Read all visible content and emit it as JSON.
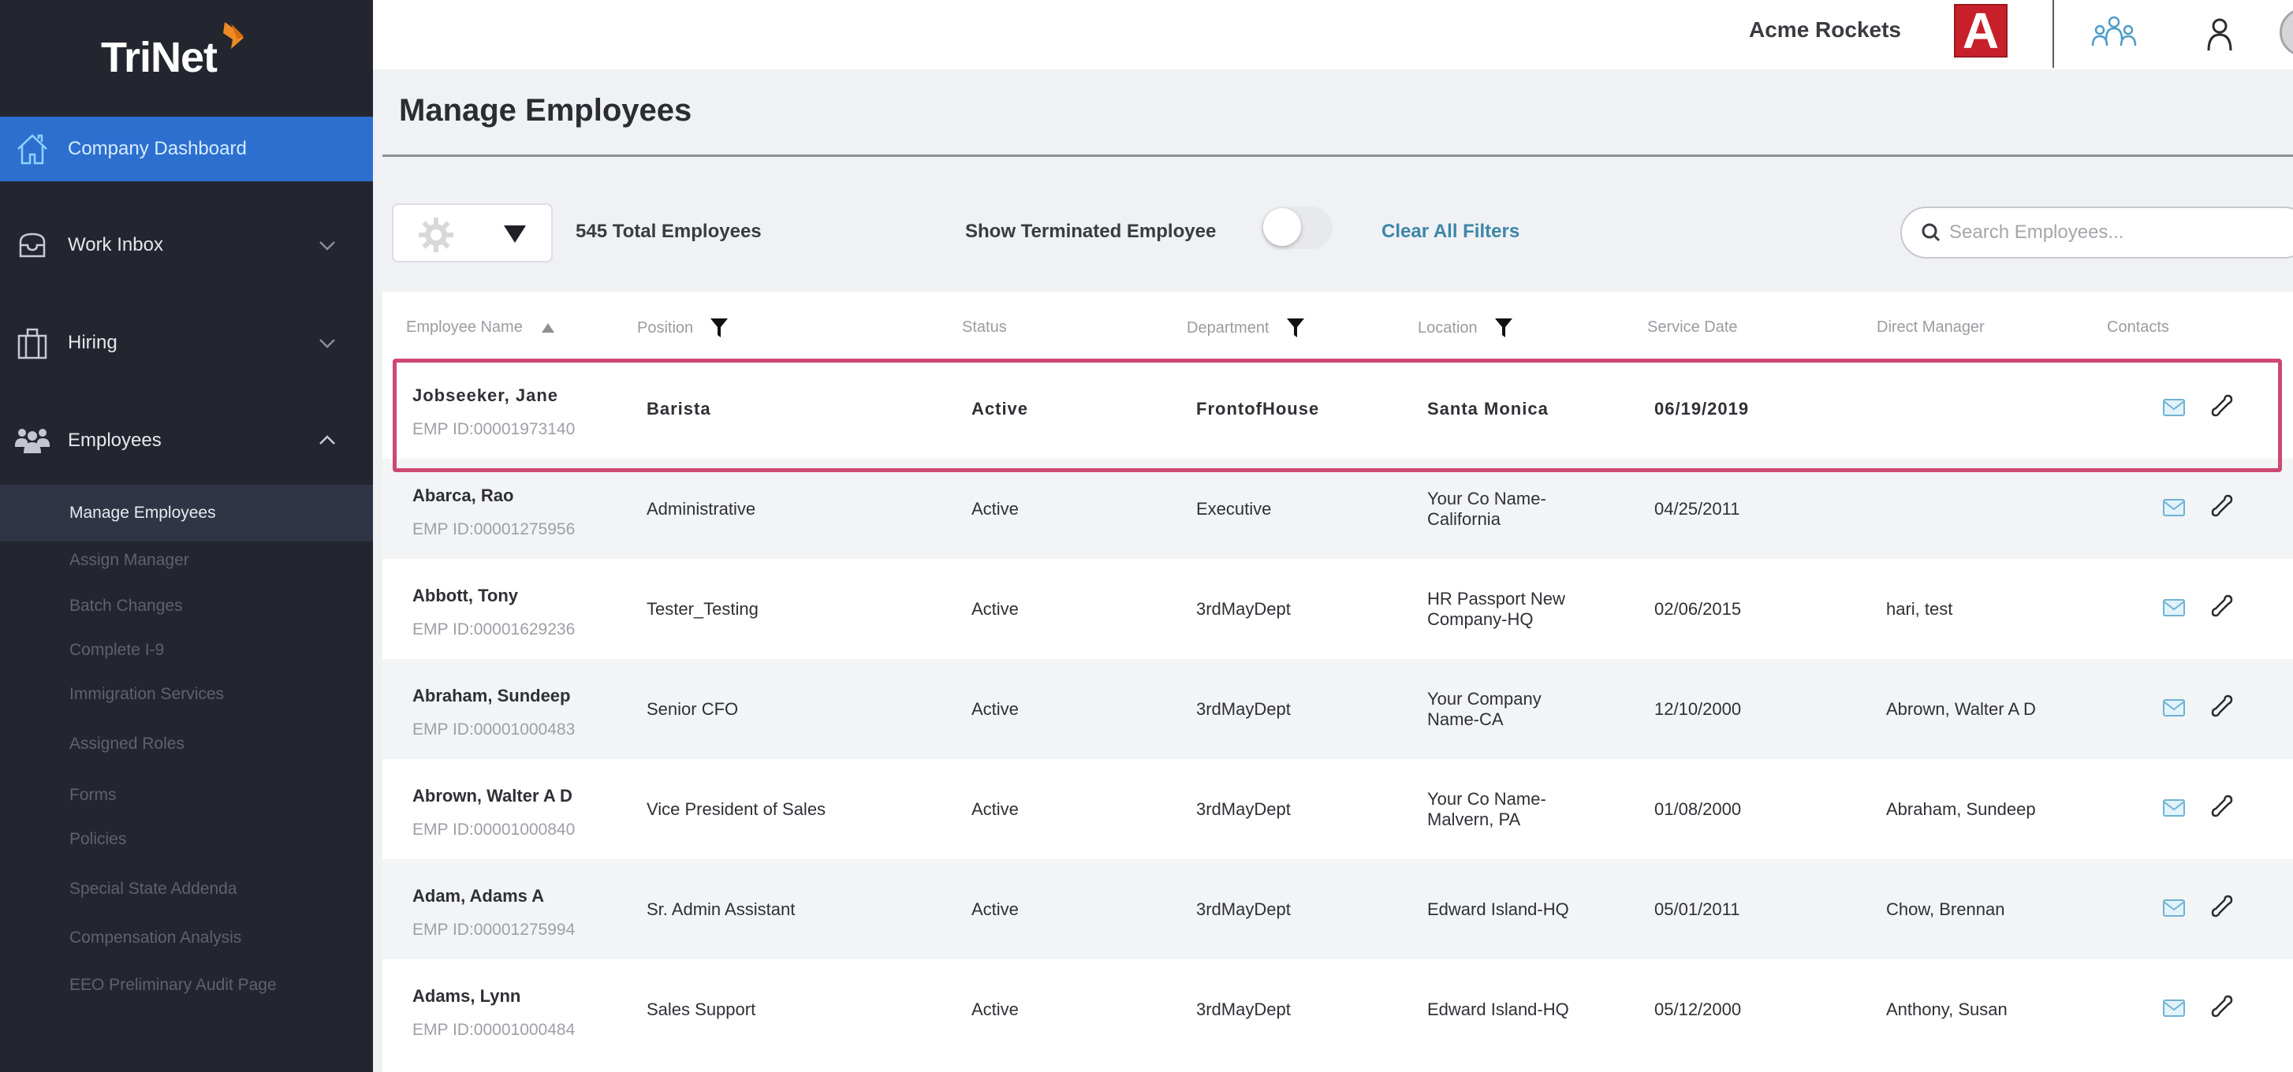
{
  "brand": {
    "name": "TriNet",
    "accent": "#f08a24"
  },
  "topbar": {
    "company_name": "Acme Rockets",
    "company_logo_letter": "A",
    "icons": [
      "team-icon",
      "user-icon",
      "avatar"
    ]
  },
  "sidebar": {
    "items": [
      {
        "label": "Company Dashboard",
        "icon": "home-icon",
        "active": true
      },
      {
        "label": "Work Inbox",
        "icon": "inbox-icon",
        "chevron": "down"
      },
      {
        "label": "Hiring",
        "icon": "briefcase-icon",
        "chevron": "down"
      },
      {
        "label": "Employees",
        "icon": "people-icon",
        "chevron": "up"
      }
    ],
    "subitems": [
      {
        "label": "Manage Employees",
        "current": true
      },
      {
        "label": "Assign Manager"
      },
      {
        "label": "Batch Changes"
      },
      {
        "label": "Complete I-9"
      },
      {
        "label": "Immigration Services"
      },
      {
        "label": "Assigned Roles"
      },
      {
        "label": "Forms"
      },
      {
        "label": "Policies"
      },
      {
        "label": "Special State Addenda"
      },
      {
        "label": "Compensation Analysis"
      },
      {
        "label": "EEO Preliminary Audit Page"
      }
    ]
  },
  "page": {
    "title": "Manage Employees",
    "total_employees": "545 Total Employees",
    "show_terminated_label": "Show Terminated Employee",
    "show_terminated_on": false,
    "clear_filters": "Clear All Filters",
    "search_placeholder": "Search Employees..."
  },
  "table": {
    "columns": [
      {
        "label": "Employee Name",
        "sort": "asc"
      },
      {
        "label": "Position",
        "filter": true
      },
      {
        "label": "Status"
      },
      {
        "label": "Department",
        "filter": true
      },
      {
        "label": "Location",
        "filter": true
      },
      {
        "label": "Service Date"
      },
      {
        "label": "Direct Manager"
      },
      {
        "label": "Contacts"
      }
    ],
    "rows": [
      {
        "name": "Jobseeker, Jane",
        "emp_id": "EMP ID:00001973140",
        "position": "Barista",
        "status": "Active",
        "department": "FrontofHouse",
        "location": "Santa Monica",
        "service_date": "06/19/2019",
        "manager": "",
        "selected": true
      },
      {
        "name": "Abarca, Rao",
        "emp_id": "EMP ID:00001275956",
        "position": "Administrative",
        "status": "Active",
        "department": "Executive",
        "location": "Your Co Name-California",
        "service_date": "04/25/2011",
        "manager": ""
      },
      {
        "name": "Abbott, Tony",
        "emp_id": "EMP ID:00001629236",
        "position": "Tester_Testing",
        "status": "Active",
        "department": "3rdMayDept",
        "location": "HR Passport New Company-HQ",
        "service_date": "02/06/2015",
        "manager": "hari, test"
      },
      {
        "name": "Abraham, Sundeep",
        "emp_id": "EMP ID:00001000483",
        "position": "Senior CFO",
        "status": "Active",
        "department": "3rdMayDept",
        "location": "Your Company Name-CA",
        "service_date": "12/10/2000",
        "manager": "Abrown, Walter A D"
      },
      {
        "name": "Abrown, Walter A D",
        "emp_id": "EMP ID:00001000840",
        "position": "Vice President of Sales",
        "status": "Active",
        "department": "3rdMayDept",
        "location": "Your Co Name-Malvern, PA",
        "service_date": "01/08/2000",
        "manager": "Abraham, Sundeep"
      },
      {
        "name": "Adam, Adams A",
        "emp_id": "EMP ID:00001275994",
        "position": "Sr. Admin Assistant",
        "status": "Active",
        "department": "3rdMayDept",
        "location": "Edward Island-HQ",
        "service_date": "05/01/2011",
        "manager": "Chow, Brennan"
      },
      {
        "name": "Adams, Lynn",
        "emp_id": "EMP ID:00001000484",
        "position": "Sales Support",
        "status": "Active",
        "department": "3rdMayDept",
        "location": "Edward Island-HQ",
        "service_date": "05/12/2000",
        "manager": "Anthony, Susan"
      }
    ]
  },
  "colors": {
    "sidebar_bg": "#23262f",
    "active_nav": "#2d6fcf",
    "highlight_outline": "#cc4872",
    "link": "#3c86a8",
    "company_logo": "#c8202a"
  }
}
